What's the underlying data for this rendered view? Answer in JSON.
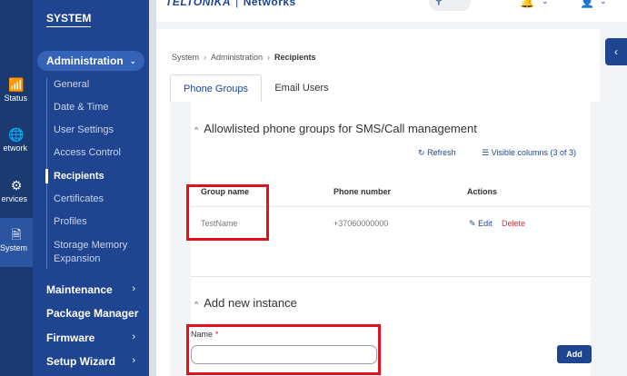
{
  "rail": {
    "items": [
      {
        "icon": "signal-icon",
        "glyph": "📶",
        "label": "Status"
      },
      {
        "icon": "globe-icon",
        "glyph": "🌐",
        "label": "etwork"
      },
      {
        "icon": "gear-icon",
        "glyph": "⚙",
        "label": "ervices"
      },
      {
        "icon": "system-icon",
        "glyph": "🗎",
        "label": "System"
      }
    ]
  },
  "nav": {
    "section_title": "SYSTEM",
    "admin_label": "Administration",
    "admin_chevron": "⌄",
    "sub_items": [
      "General",
      "Date & Time",
      "User Settings",
      "Access Control",
      "Recipients",
      "Certificates",
      "Profiles",
      "Storage Memory",
      "Expansion"
    ],
    "main_items": [
      {
        "label": "Maintenance",
        "chevron": "›"
      },
      {
        "label": "Package Manager",
        "chevron": ""
      },
      {
        "label": "Firmware",
        "chevron": "›"
      },
      {
        "label": "Setup Wizard",
        "chevron": "›"
      }
    ]
  },
  "header": {
    "brand": "TELTONIKA",
    "separator": "|",
    "brand_suffix": "Networks",
    "search_glyph": "⚲",
    "search_shortcut": "/",
    "bell_glyph": "🔔",
    "user_glyph": "👤",
    "chevron": "⌄"
  },
  "collapse_glyph": "‹",
  "breadcrumb": {
    "items": [
      "System",
      "Administration"
    ],
    "current": "Recipients",
    "sep": "›"
  },
  "tabs": {
    "phone_groups": "Phone Groups",
    "email_users": "Email Users"
  },
  "section1": {
    "caret": "^",
    "title": "Allowlisted phone groups for SMS/Call management",
    "refresh_glyph": "↻",
    "refresh_label": "Refresh",
    "columns_glyph": "☰",
    "columns_label": "Visible columns (3 of 3)"
  },
  "table": {
    "headers": {
      "group_name": "Group name",
      "phone_number": "Phone number",
      "actions": "Actions"
    },
    "row": {
      "group_name": "TestName",
      "phone_number": "+37060000000",
      "edit_glyph": "✎",
      "edit_label": "Edit",
      "delete_label": "Delete"
    }
  },
  "section2": {
    "caret": "^",
    "title": "Add new instance",
    "name_label": "Name",
    "required_mark": "*",
    "name_value": "",
    "add_label": "Add"
  },
  "colors": {
    "primary": "#1f4591",
    "rail": "#1b3a72",
    "highlight": "#e2101c",
    "danger": "#d9303c"
  }
}
